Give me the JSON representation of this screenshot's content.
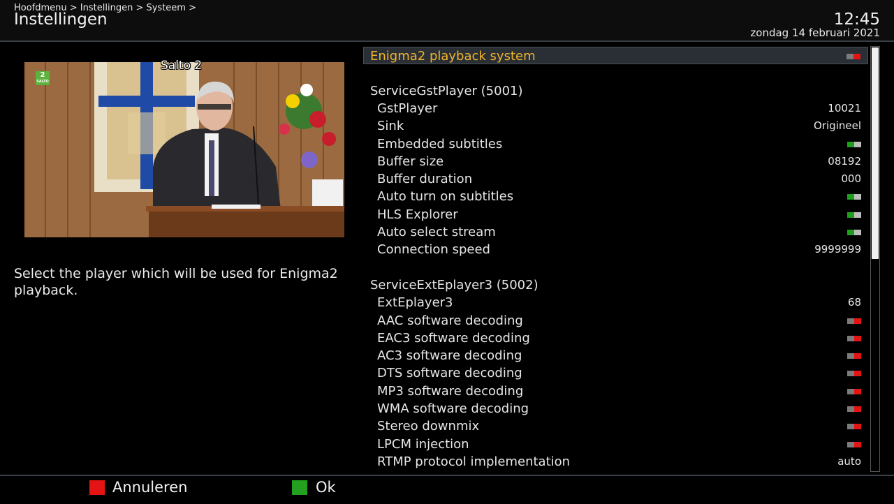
{
  "header": {
    "breadcrumb": "Hoofdmenu > Instellingen > Systeem >",
    "title": "Instellingen",
    "time": "12:45",
    "date": "zondag 14 februari 2021"
  },
  "preview": {
    "channel_name": "Salto 2",
    "logo_number": "2",
    "logo_text": "SALTO"
  },
  "description": "Select the player which will be used for Enigma2 playback.",
  "settings": {
    "items": [
      {
        "type": "item",
        "label": "Enigma2 playback system",
        "toggle": "off",
        "selected": true
      },
      {
        "type": "spacer"
      },
      {
        "type": "section",
        "label": "ServiceGstPlayer (5001)"
      },
      {
        "type": "item",
        "label": "GstPlayer",
        "value": "10021"
      },
      {
        "type": "item",
        "label": "Sink",
        "value": "Origineel"
      },
      {
        "type": "item",
        "label": "Embedded subtitles",
        "toggle": "on"
      },
      {
        "type": "item",
        "label": "Buffer size",
        "value": "08192"
      },
      {
        "type": "item",
        "label": "Buffer duration",
        "value": "000"
      },
      {
        "type": "item",
        "label": "Auto turn on subtitles",
        "toggle": "on"
      },
      {
        "type": "item",
        "label": "HLS Explorer",
        "toggle": "on"
      },
      {
        "type": "item",
        "label": "Auto select stream",
        "toggle": "on"
      },
      {
        "type": "item",
        "label": "Connection speed",
        "value": "9999999"
      },
      {
        "type": "spacer"
      },
      {
        "type": "section",
        "label": "ServiceExtEplayer3 (5002)"
      },
      {
        "type": "item",
        "label": "ExtEplayer3",
        "value": "68"
      },
      {
        "type": "item",
        "label": "AAC software decoding",
        "toggle": "off"
      },
      {
        "type": "item",
        "label": "EAC3 software decoding",
        "toggle": "off"
      },
      {
        "type": "item",
        "label": "AC3 software decoding",
        "toggle": "off"
      },
      {
        "type": "item",
        "label": "DTS software decoding",
        "toggle": "off"
      },
      {
        "type": "item",
        "label": "MP3 software decoding",
        "toggle": "off"
      },
      {
        "type": "item",
        "label": "WMA software decoding",
        "toggle": "off"
      },
      {
        "type": "item",
        "label": "Stereo downmix",
        "toggle": "off"
      },
      {
        "type": "item",
        "label": "LPCM injection",
        "toggle": "off"
      },
      {
        "type": "item",
        "label": "RTMP protocol implementation",
        "value": "auto"
      }
    ],
    "scroll_fraction_visible": 0.5
  },
  "footer": {
    "red_label": "Annuleren",
    "green_label": "Ok"
  },
  "colors": {
    "selected_text": "#f0b429",
    "toggle_off": "#e51414",
    "toggle_on": "#1ea01e",
    "key_red": "#e51414",
    "key_green": "#23a020"
  }
}
